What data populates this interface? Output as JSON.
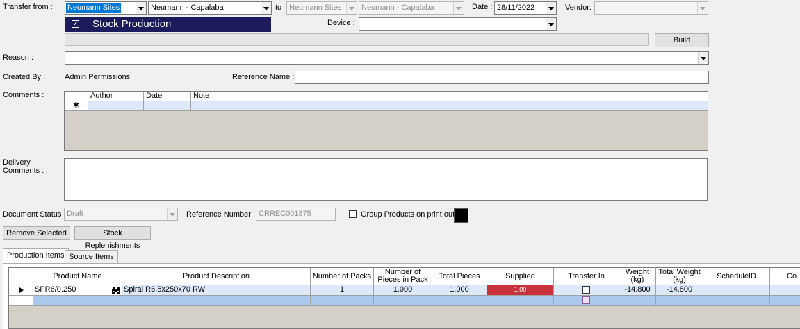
{
  "transfer": {
    "from_label": "Transfer from :",
    "from_site": "Neumann Sites",
    "from_location": "Neumann - Capalaba",
    "to_label": "to",
    "to_site": "Neumann Sites",
    "to_location": "Neumann - Capalaba",
    "date_label": "Date :",
    "date_value": "28/11/2022",
    "vendor_label": "Vendor:",
    "vendor_value": ""
  },
  "stock_production": {
    "label": "Stock Production",
    "checked": true
  },
  "device": {
    "label": "Device :",
    "value": ""
  },
  "build_button": "Build",
  "reason": {
    "label": "Reason :",
    "value": ""
  },
  "created_by": {
    "label": "Created By :",
    "value": "Admin Permissions"
  },
  "reference_name": {
    "label": "Reference Name :",
    "value": ""
  },
  "comments": {
    "label": "Comments :",
    "columns": [
      "Author",
      "Date",
      "Note"
    ],
    "new_row_marker": "✱"
  },
  "delivery_comments": {
    "label_line1": "Delivery",
    "label_line2": "Comments :",
    "value": ""
  },
  "document_status": {
    "label": "Document Status :",
    "value": "Draft"
  },
  "reference_number": {
    "label": "Reference Number :",
    "value": "CRREC001875"
  },
  "group_products": {
    "label": "Group Products on print out",
    "checked": false
  },
  "color_swatch": "#000000",
  "buttons": {
    "remove_selected": "Remove Selected",
    "stock_replenishments": "Stock Replenishments"
  },
  "tabs": [
    {
      "label": "Production Items",
      "active": true
    },
    {
      "label": "Source Items",
      "active": false
    }
  ],
  "production_grid": {
    "columns": [
      "Product Name",
      "Product Description",
      "Number of Packs",
      "Number of Pieces in Pack",
      "Total Pieces",
      "Supplied",
      "Transfer In",
      "Weight (kg)",
      "Total Weight (kg)",
      "ScheduleID",
      "Co"
    ],
    "rows": [
      {
        "product_name": "SPR6/0.250",
        "product_description": "Spiral R6.5x250x70 RW",
        "number_of_packs": "1",
        "pieces_in_pack": "1.000",
        "total_pieces": "1.000",
        "supplied": "1.00",
        "transfer_in": false,
        "weight": "-14.800",
        "total_weight": "-14.800",
        "schedule_id": ""
      }
    ]
  },
  "colors": {
    "supplied_bg": "#c8323c",
    "selection": "#0078d7",
    "stock_banner": "#1c1c5c"
  },
  "icons": {
    "lookup": "binoculars-icon",
    "row_pointer": "triangle-right-icon",
    "checkbox": "checkbox-icon"
  }
}
